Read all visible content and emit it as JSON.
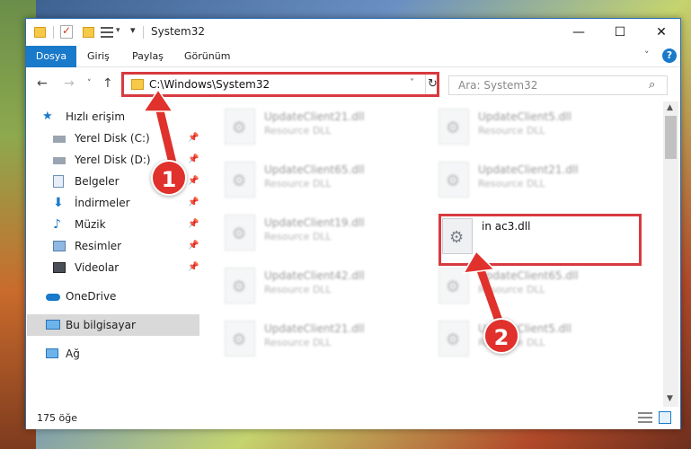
{
  "window": {
    "title": "System32",
    "minimize": "—",
    "maximize": "☐",
    "close": "✕"
  },
  "ribbon": {
    "tabs": [
      "Dosya",
      "Giriş",
      "Paylaş",
      "Görünüm"
    ],
    "expand": "˅",
    "help": "?"
  },
  "nav": {
    "back": "←",
    "forward": "→",
    "recent": "˅",
    "up": "↑"
  },
  "address": {
    "path": "C:\\Windows\\System32",
    "dropdown": "˅",
    "refresh": "↻"
  },
  "search": {
    "placeholder": "Ara: System32",
    "icon": "⌕"
  },
  "sidebar": {
    "items": [
      {
        "label": "Hızlı erişim",
        "icon": "star-icon",
        "pinned": false
      },
      {
        "label": "Yerel Disk (C:)",
        "icon": "drive-icon",
        "pinned": true
      },
      {
        "label": "Yerel Disk (D:)",
        "icon": "drive-icon",
        "pinned": true
      },
      {
        "label": "Belgeler",
        "icon": "documents-icon",
        "pinned": true
      },
      {
        "label": "İndirmeler",
        "icon": "download-icon",
        "pinned": true
      },
      {
        "label": "Müzik",
        "icon": "music-icon",
        "pinned": true
      },
      {
        "label": "Resimler",
        "icon": "pictures-icon",
        "pinned": true
      },
      {
        "label": "Videolar",
        "icon": "video-icon",
        "pinned": true
      },
      {
        "label": "OneDrive",
        "icon": "cloud-icon",
        "pinned": false
      },
      {
        "label": "Bu bilgisayar",
        "icon": "computer-icon",
        "pinned": false
      },
      {
        "label": "Ağ",
        "icon": "network-icon",
        "pinned": false
      }
    ],
    "pin_glyph": "📌"
  },
  "files": {
    "left": [
      {
        "name": "UpdateClient21.dll",
        "type": "Resource DLL"
      },
      {
        "name": "UpdateClient65.dll",
        "type": "Resource DLL"
      },
      {
        "name": "UpdateClient19.dll",
        "type": "Resource DLL"
      },
      {
        "name": "UpdateClient42.dll",
        "type": "Resource DLL"
      },
      {
        "name": "UpdateClient21.dll",
        "type": "Resource DLL"
      }
    ],
    "right": [
      {
        "name": "UpdateClient5.dll",
        "type": "Resource DLL"
      },
      {
        "name": "UpdateClient21.dll",
        "type": "Resource DLL"
      },
      {
        "name": "in ac3.dll",
        "type": ""
      },
      {
        "name": "UpdateClient65.dll",
        "type": "Resource DLL"
      },
      {
        "name": "UpdateClient5.dll",
        "type": "Resource DLL"
      }
    ]
  },
  "status": {
    "count": "175 öğe"
  },
  "annotations": {
    "badge1": "1",
    "badge2": "2",
    "color": "#e0312c"
  },
  "scroll": {
    "up": "▲",
    "down": "▼"
  }
}
